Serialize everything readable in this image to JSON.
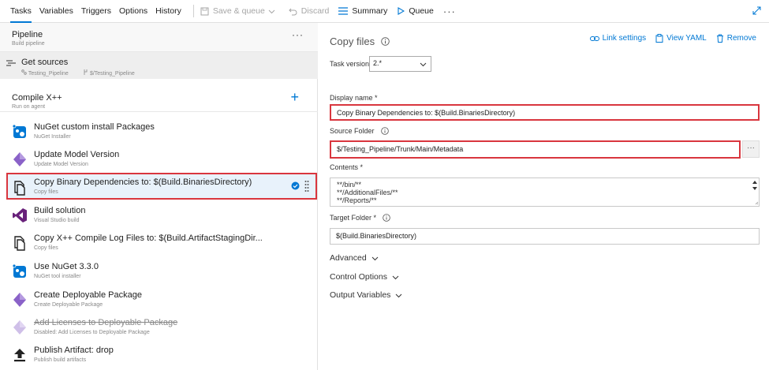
{
  "toolbar": {
    "tabs": [
      "Tasks",
      "Variables",
      "Triggers",
      "Options",
      "History"
    ],
    "save_queue": "Save & queue",
    "discard": "Discard",
    "summary": "Summary",
    "queue": "Queue",
    "more": "···"
  },
  "pipeline": {
    "title": "Pipeline",
    "subtitle": "Build pipeline",
    "more": "···"
  },
  "get_sources": {
    "title": "Get sources",
    "repo": "Testing_Pipeline",
    "path": "$/Testing_Pipeline"
  },
  "job": {
    "title": "Compile X++",
    "subtitle": "Run on agent",
    "add": "+"
  },
  "tasks": [
    {
      "name": "NuGet custom install Packages",
      "sub": "NuGet Installer"
    },
    {
      "name": "Update Model Version",
      "sub": "Update Model Version"
    },
    {
      "name": "Copy Binary Dependencies to: $(Build.BinariesDirectory)",
      "sub": "Copy files"
    },
    {
      "name": "Build solution",
      "sub": "Visual Studio build"
    },
    {
      "name": "Copy X++ Compile Log Files to: $(Build.ArtifactStagingDir...",
      "sub": "Copy files"
    },
    {
      "name": "Use NuGet 3.3.0",
      "sub": "NuGet tool installer"
    },
    {
      "name": "Create Deployable Package",
      "sub": "Create Deployable Package"
    },
    {
      "name": "Add Licenses to Deployable Package",
      "sub": "Disabled: Add Licenses to Deployable Package"
    },
    {
      "name": "Publish Artifact: drop",
      "sub": "Publish build artifacts"
    }
  ],
  "detail": {
    "title": "Copy files",
    "link_settings": "Link settings",
    "view_yaml": "View YAML",
    "remove": "Remove",
    "task_version_label": "Task version",
    "task_version_value": "2.*",
    "display_name_label": "Display name *",
    "display_name_value": "Copy Binary Dependencies to: $(Build.BinariesDirectory)",
    "source_folder_label": "Source Folder",
    "source_folder_value": "$/Testing_Pipeline/Trunk/Main/Metadata",
    "source_folder_more": "···",
    "contents_label": "Contents *",
    "contents_lines": [
      "**/bin/**",
      "**/AdditionalFiles/**",
      "**/Reports/**"
    ],
    "target_folder_label": "Target Folder *",
    "target_folder_value": "$(Build.BinariesDirectory)",
    "sections": [
      "Advanced",
      "Control Options",
      "Output Variables"
    ]
  },
  "colors": {
    "accent": "#0078d4",
    "highlight_border": "#d9363e",
    "selected_bg": "#e8f2fb"
  }
}
